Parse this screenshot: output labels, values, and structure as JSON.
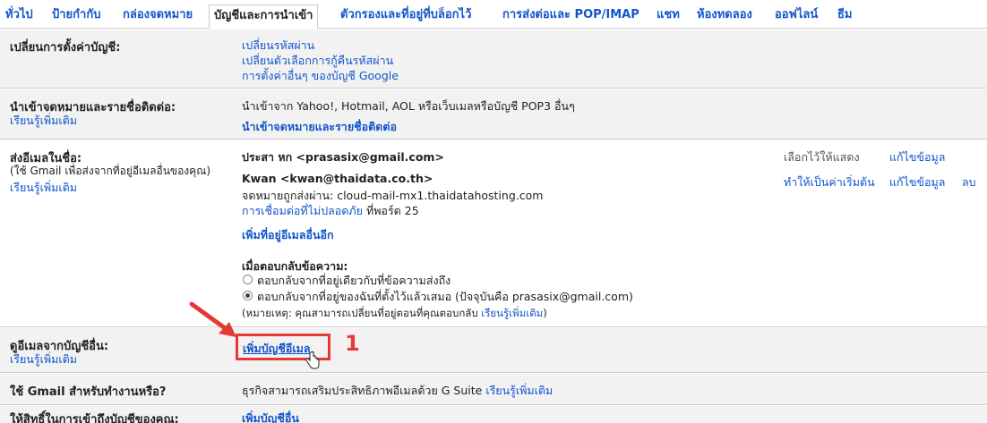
{
  "tabs": [
    {
      "label": "ทั่วไป",
      "active": false
    },
    {
      "label": "ป้ายกำกับ",
      "active": false
    },
    {
      "label": "กล่องจดหมาย",
      "active": false
    },
    {
      "label": "บัญชีและการนำเข้า",
      "active": true
    },
    {
      "label": "ตัวกรองและที่อยู่ที่บล็อกไว้",
      "active": false
    },
    {
      "label": "การส่งต่อและ POP/IMAP",
      "active": false
    },
    {
      "label": "แชท",
      "active": false
    },
    {
      "label": "ห้องทดลอง",
      "active": false
    },
    {
      "label": "ออฟไลน์",
      "active": false
    },
    {
      "label": "ธีม",
      "active": false
    }
  ],
  "change_account": {
    "label": "เปลี่ยนการตั้งค่าบัญชี:",
    "links": [
      "เปลี่ยนรหัสผ่าน",
      "เปลี่ยนตัวเลือกการกู้คืนรหัสผ่าน",
      "การตั้งค่าอื่นๆ ของบัญชี Google"
    ]
  },
  "import": {
    "label": "นำเข้าจดหมายและรายชื่อติดต่อ:",
    "learn_more": "เรียนรู้เพิ่มเติม",
    "description": "นำเข้าจาก Yahoo!, Hotmail, AOL หรือเว็บเมลหรือบัญชี POP3 อื่นๆ",
    "action": "นำเข้าจดหมายและรายชื่อติดต่อ"
  },
  "send_as": {
    "label": "ส่งอีเมลในชื่อ:",
    "sub": "(ใช้ Gmail เพื่อส่งจากที่อยู่อีเมลอื่นของคุณ)",
    "learn_more": "เรียนรู้เพิ่มเติม",
    "account1": "ประสา หก <prasasix@gmail.com>",
    "account2": "Kwan <kwan@thaidata.co.th>",
    "account2_via": "จดหมายถูกส่งผ่าน: cloud-mail-mx1.thaidatahosting.com",
    "account2_insecure": "การเชื่อมต่อที่ไม่ปลอดภัย",
    "account2_port": " ที่พอร์ต 25",
    "add_another": "เพิ่มที่อยู่อีเมลอื่นอีก",
    "reply_heading": "เมื่อตอบกลับข้อความ:",
    "reply_option1": "ตอบกลับจากที่อยู่เดียวกับที่ข้อความส่งถึง",
    "reply_option2": "ตอบกลับจากที่อยู่ของฉันที่ตั้งไว้แล้วเสมอ (ปัจจุบันคือ prasasix@gmail.com)",
    "note_prefix": "(หมายเหตุ: คุณสามารถเปลี่ยนที่อยู่ตอนที่คุณตอบกลับ ",
    "note_link": "เรียนรู้เพิ่มเติม",
    "note_suffix": ")",
    "row1_default": "เลือกไว้ให้แสดง",
    "row1_edit": "แก้ไขข้อมูล",
    "row2_make_default": "ทำให้เป็นค่าเริ่มต้น",
    "row2_edit": "แก้ไขข้อมูล",
    "row2_delete": "ลบ"
  },
  "check_mail": {
    "label": "ดูอีเมลจากบัญชีอื่น:",
    "learn_more": "เรียนรู้เพิ่มเติม",
    "action": "เพิ่มบัญชีอีเมล",
    "annotation_number": "1"
  },
  "gsuite": {
    "label": "ใช้ Gmail สำหรับทำงานหรือ?",
    "text": "ธุรกิจสามารถเสริมประสิทธิภาพอีเมลด้วย G Suite ",
    "learn_more": "เรียนรู้เพิ่มเติม"
  },
  "grant_access": {
    "label": "ให้สิทธิ์ในการเข้าถึงบัญชีของคุณ:",
    "action": "เพิ่มบัญชีอื่น"
  },
  "colors": {
    "link": "#1155cc",
    "annotation": "#e53935",
    "shaded_bg": "#f2f2f2"
  }
}
